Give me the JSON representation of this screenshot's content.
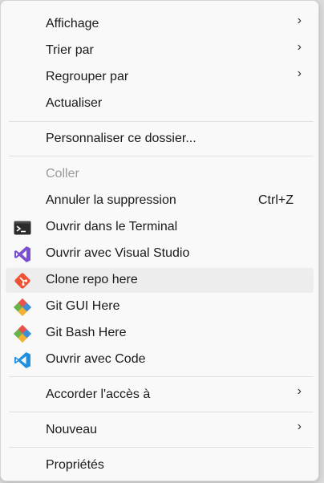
{
  "menu": {
    "items": [
      {
        "label": "Affichage",
        "submenu": true
      },
      {
        "label": "Trier par",
        "submenu": true
      },
      {
        "label": "Regrouper par",
        "submenu": true
      },
      {
        "label": "Actualiser"
      },
      {
        "label": "Personnaliser ce dossier..."
      },
      {
        "label": "Coller",
        "disabled": true
      },
      {
        "label": "Annuler la suppression",
        "shortcut": "Ctrl+Z"
      },
      {
        "label": "Ouvrir dans le Terminal",
        "icon": "terminal-icon"
      },
      {
        "label": "Ouvrir avec Visual Studio",
        "icon": "visual-studio-icon"
      },
      {
        "label": "Clone repo here",
        "icon": "git-clone-icon",
        "highlighted": true
      },
      {
        "label": "Git GUI Here",
        "icon": "git-gui-icon"
      },
      {
        "label": "Git Bash Here",
        "icon": "git-bash-icon"
      },
      {
        "label": "Ouvrir avec Code",
        "icon": "vscode-icon"
      },
      {
        "label": "Accorder l'accès à",
        "submenu": true
      },
      {
        "label": "Nouveau",
        "submenu": true
      },
      {
        "label": "Propriétés"
      }
    ],
    "chevron_glyph": "›"
  }
}
